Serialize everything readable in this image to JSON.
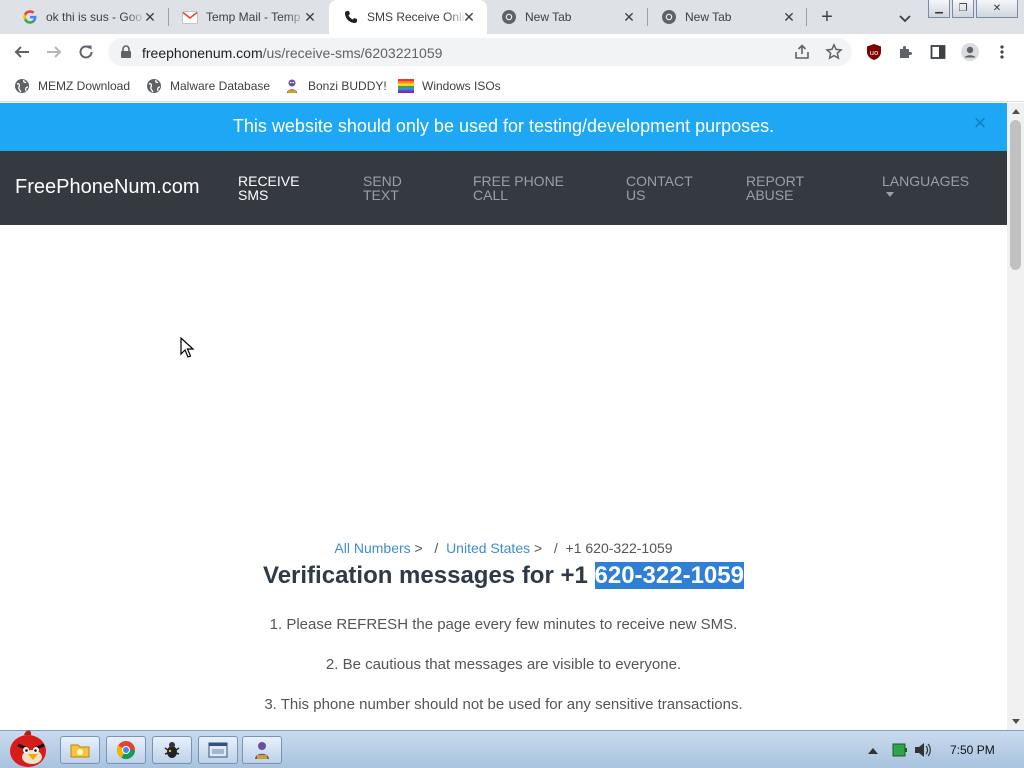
{
  "browser": {
    "tabs": [
      {
        "title": "ok thi is sus - Goo",
        "icon": "google-icon",
        "active": false
      },
      {
        "title": "Temp Mail - Temp",
        "icon": "gmail-icon",
        "active": false
      },
      {
        "title": "SMS Receive Onli",
        "icon": "phone-icon",
        "active": true
      },
      {
        "title": "New Tab",
        "icon": "chrome-icon",
        "active": false
      },
      {
        "title": "New Tab",
        "icon": "chrome-icon",
        "active": false
      }
    ],
    "url_host": "freephonenum.com",
    "url_path": "/us/receive-sms/6203221059",
    "bookmarks": [
      {
        "label": "MEMZ Download",
        "icon": "globe-icon"
      },
      {
        "label": "Malware Database",
        "icon": "globe-icon"
      },
      {
        "label": "Bonzi BUDDY!",
        "icon": "bonzi-icon"
      },
      {
        "label": "Windows ISOs",
        "icon": "windows-flag-icon"
      }
    ],
    "extension_badge": "uo"
  },
  "site": {
    "banner_text": "This website should only be used for testing/development purposes.",
    "banner_close": "×",
    "brand": "FreePhoneNum.com",
    "nav": [
      {
        "line1": "RECEIVE",
        "line2": "SMS",
        "active": true
      },
      {
        "line1": "SEND",
        "line2": "TEXT",
        "active": false
      },
      {
        "line1": "FREE PHONE",
        "line2": "CALL",
        "active": false
      },
      {
        "line1": "CONTACT",
        "line2": "US",
        "active": false
      },
      {
        "line1": "REPORT",
        "line2": "ABUSE",
        "active": false
      },
      {
        "line1": "LANGUAGES",
        "line2": "",
        "active": false
      }
    ],
    "breadcrumb": {
      "all_numbers": "All Numbers",
      "sep1": " >   /  ",
      "country": "United States",
      "sep2": " >   /  ",
      "current": "+1 620-322-1059"
    },
    "heading_prefix": "Verification messages for +1 ",
    "heading_number": "620-322-1059",
    "notes": [
      "1. Please REFRESH the page every few minutes to receive new SMS.",
      "2. Be cautious that messages are visible to everyone.",
      "3. This phone number should not be used for any sensitive transactions."
    ]
  },
  "taskbar": {
    "clock": "7:50 PM"
  },
  "colors": {
    "banner": "#1ea7f4",
    "nav_bg": "#343a40",
    "link": "#3e8ed0",
    "highlight": "#2f7fd6"
  }
}
